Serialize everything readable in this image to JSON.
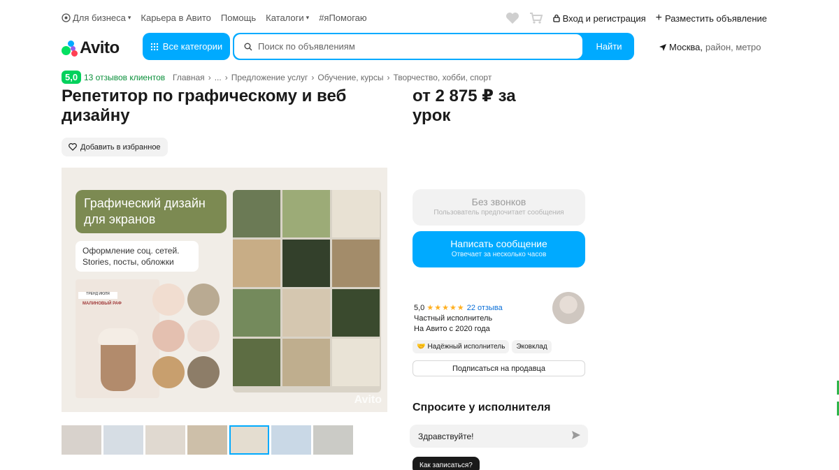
{
  "topbar": {
    "business": "Для бизнеса",
    "career": "Карьера в Авито",
    "help": "Помощь",
    "catalogs": "Каталоги",
    "ihelp": "#яПомогаю",
    "login": "Вход и регистрация",
    "post_ad": "Разместить объявление"
  },
  "header": {
    "logo": "Avito",
    "categories_btn": "Все категории",
    "search_placeholder": "Поиск по объявлениям",
    "search_btn": "Найти",
    "location_city": "Москва,",
    "location_rest": "район, метро"
  },
  "breadcrumbs": {
    "rating": "5,0",
    "reviews": "13 отзывов клиентов",
    "items": [
      "Главная",
      "›",
      "...",
      "›",
      "Предложение услуг",
      "›",
      "Обучение, курсы",
      "›",
      "Творчество, хобби, спорт"
    ]
  },
  "listing": {
    "title": "Репетитор по графическому и веб дизайну",
    "price": "от 2 875 ₽ за урок",
    "favorite_btn": "Добавить в избранное"
  },
  "image": {
    "headline": "Графический дизайн для экранов",
    "subline": "Оформление соц. сетей. Stories, посты, обложки",
    "card_tag": "ТРЕНД ИЮЛЯ",
    "card_label": "МАЛИНОВЫЙ РАФ",
    "watermark": "Avito",
    "thumbnail_count": 7,
    "active_thumbnail": 5
  },
  "contact": {
    "no_calls": "Без звонков",
    "no_calls_sub": "Пользователь предпочитает сообщения",
    "write_msg": "Написать сообщение",
    "write_msg_sub": "Отвечает за несколько часов"
  },
  "seller": {
    "rating": "5,0",
    "stars": "★★★★★",
    "reviews": "22 отзыва",
    "type": "Частный исполнитель",
    "since": "На Авито с 2020 года",
    "chip_reliable": "Надёжный исполнитель",
    "chip_invest": "Эковклад",
    "subscribe": "Подписаться на продавца"
  },
  "ask": {
    "title": "Спросите у исполнителя",
    "input_value": "Здравствуйте!",
    "how_btn": "Как записаться?"
  },
  "colors": {
    "accent": "#00aaff",
    "rating_green": "#02d15c",
    "review_green": "#0a8f3a"
  }
}
